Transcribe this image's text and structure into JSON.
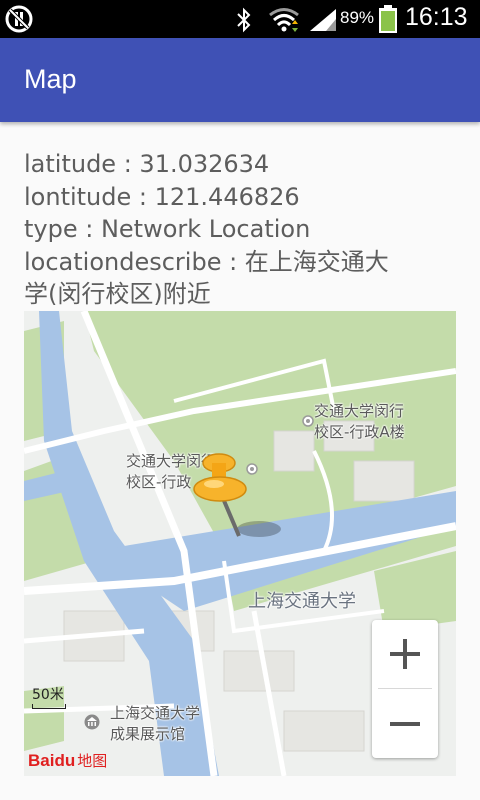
{
  "status_bar": {
    "battery_percent": "89%",
    "time": "16:13",
    "icons": [
      "notification-icon",
      "bluetooth-icon",
      "wifi-icon",
      "signal-icon",
      "battery-icon"
    ]
  },
  "app_bar": {
    "title": "Map",
    "color": "#3f51b5"
  },
  "info": {
    "latitude": "latitude : 31.032634",
    "longitude": "lontitude : 121.446826",
    "type": "type : Network Location",
    "describe_line1": "locationdescribe : 在上海交通大",
    "describe_line2": "学(闵行校区)附近"
  },
  "map": {
    "labels": {
      "admin_a_line1": "交通大学闵行",
      "admin_a_line2": "校区-行政A楼",
      "admin_b_line1": "交通大学闵行",
      "admin_b_line2": "校区-行政",
      "sjtu": "上海交通大学",
      "gallery_line1": "上海交通大学",
      "gallery_line2": "成果展示馆"
    },
    "scale": "50米",
    "logo_text": "Baidu",
    "logo_suffix": "地图",
    "zoom_in": "+",
    "zoom_out": "−",
    "colors": {
      "water": "#a6c3e6",
      "green": "#c4dcaa",
      "road": "#ffffff",
      "land": "#eef0ee"
    }
  }
}
